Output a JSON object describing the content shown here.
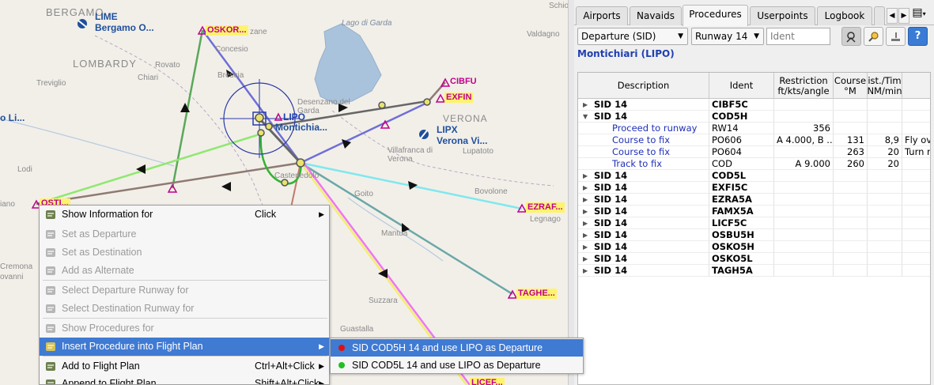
{
  "map": {
    "labels": {
      "bergamo": "BERGAMO",
      "lime_code": "LIME",
      "lime_name": "Bergamo O...",
      "lombardy": "LOMBARDY",
      "rovato": "Rovato",
      "treviglio": "Treviglio",
      "chiari": "Chiari",
      "concesio": "Concesio",
      "lago": "Lago di Garda",
      "valdagno": "Valdagno",
      "schio": "Schio",
      "brescia": "Brescia",
      "desenzano": "Desenzano del\nGarda",
      "verona": "VERONA",
      "lipx_code": "LIPX",
      "lipx_name": "Verona Vi...",
      "villafranca": "Villafranca di\nVerona",
      "lupatoto": "Lupatoto",
      "lipo_code": "LIPO",
      "lipo_name": "Montichia...",
      "castenedolo": "Castenedolo",
      "zane": "zane",
      "lodi": "Lodi",
      "lo_left": "o Li...",
      "iano": "iano",
      "goito": "Goito",
      "bovolone": "Bovolone",
      "legnago": "Legnago",
      "mantua": "Mantua",
      "suzzara": "Suzzara",
      "guastalla": "Guastalla",
      "vanni": "ovanni",
      "cremona": "Cremona"
    },
    "fixes": {
      "oskor": "OSKOR...",
      "cibfu": "CIBFU",
      "exfin": "EXFIN",
      "ezraf": "EZRAF...",
      "taghe": "TAGHE...",
      "licef": "LICEF...",
      "ostil": "OSTI..."
    },
    "colors": {
      "background": "#f2efe9",
      "lake": "#aac3dc",
      "route_green_dark": "#5aa85a",
      "route_green_light": "#8fe86f",
      "route_blue": "#6f6fd8",
      "route_brown": "#8e7a72",
      "route_cyan": "#7fe8ee",
      "route_teal": "#6aa8a8",
      "route_magenta": "#ee77ee",
      "route_yellow": "#f2ee6f",
      "route_grey": "#666666",
      "fix": "#c0008a"
    }
  },
  "panel": {
    "tabs": [
      {
        "label": "Airports",
        "active": false
      },
      {
        "label": "Navaids",
        "active": false
      },
      {
        "label": "Procedures",
        "active": true
      },
      {
        "label": "Userpoints",
        "active": false
      },
      {
        "label": "Logbook",
        "active": false
      }
    ],
    "tab_more_label": "",
    "menu_icon": "panel-menu-icon",
    "filter": {
      "type_value": "Departure (SID)",
      "runway_value": "Runway 14",
      "ident_placeholder": "Ident"
    },
    "toolbar_icons": [
      "follow-selection-icon",
      "search-icon",
      "clear-selection-icon",
      "help-icon"
    ],
    "help_label": "?",
    "airport_title": "Montichiari (LIPO)",
    "table": {
      "headers": [
        "Description",
        "Ident",
        "Restriction\nft/kts/angle",
        "Course\n°M",
        "ist./Tim\nNM/min",
        ""
      ],
      "rows": [
        {
          "type": "parent",
          "expanded": false,
          "desc": "SID 14",
          "ident": "CIBF5C",
          "restr": "",
          "course": "",
          "dist": "",
          "remarks": ""
        },
        {
          "type": "parent",
          "expanded": true,
          "desc": "SID 14",
          "ident": "COD5H",
          "restr": "",
          "course": "",
          "dist": "",
          "remarks": ""
        },
        {
          "type": "child",
          "desc": "Proceed to runway",
          "ident": "RW14",
          "restr": "356",
          "course": "",
          "dist": "",
          "remarks": ""
        },
        {
          "type": "child",
          "desc": "Course to fix",
          "ident": "PO606",
          "restr": "A 4.000, B ...",
          "course": "131",
          "dist": "8,9",
          "remarks": "Fly ov"
        },
        {
          "type": "child",
          "desc": "Course to fix",
          "ident": "PO604",
          "restr": "",
          "course": "263",
          "dist": "20",
          "remarks": "Turn r"
        },
        {
          "type": "child",
          "desc": "Track to fix",
          "ident": "COD",
          "restr": "A 9.000",
          "course": "260",
          "dist": "20",
          "remarks": ""
        },
        {
          "type": "parent",
          "expanded": false,
          "desc": "SID 14",
          "ident": "COD5L",
          "restr": "",
          "course": "",
          "dist": "",
          "remarks": ""
        },
        {
          "type": "parent",
          "expanded": false,
          "desc": "SID 14",
          "ident": "EXFI5C",
          "restr": "",
          "course": "",
          "dist": "",
          "remarks": ""
        },
        {
          "type": "parent",
          "expanded": false,
          "desc": "SID 14",
          "ident": "EZRA5A",
          "restr": "",
          "course": "",
          "dist": "",
          "remarks": ""
        },
        {
          "type": "parent",
          "expanded": false,
          "desc": "SID 14",
          "ident": "FAMX5A",
          "restr": "",
          "course": "",
          "dist": "",
          "remarks": ""
        },
        {
          "type": "parent",
          "expanded": false,
          "desc": "SID 14",
          "ident": "LICF5C",
          "restr": "",
          "course": "",
          "dist": "",
          "remarks": ""
        },
        {
          "type": "parent",
          "expanded": false,
          "desc": "SID 14",
          "ident": "OSBU5H",
          "restr": "",
          "course": "",
          "dist": "",
          "remarks": ""
        },
        {
          "type": "parent",
          "expanded": false,
          "desc": "SID 14",
          "ident": "OSKO5H",
          "restr": "",
          "course": "",
          "dist": "",
          "remarks": ""
        },
        {
          "type": "parent",
          "expanded": false,
          "desc": "SID 14",
          "ident": "OSKO5L",
          "restr": "",
          "course": "",
          "dist": "",
          "remarks": ""
        },
        {
          "type": "parent",
          "expanded": false,
          "desc": "SID 14",
          "ident": "TAGH5A",
          "restr": "",
          "course": "",
          "dist": "",
          "remarks": ""
        }
      ]
    }
  },
  "context_menu": {
    "items": [
      {
        "label": "Show Information for",
        "shortcut": "Click",
        "submenu": true,
        "disabled": false,
        "highlighted": false,
        "icon": "info-icon"
      },
      {
        "label": "Set  as Departure",
        "shortcut": "",
        "submenu": false,
        "disabled": true,
        "highlighted": false,
        "icon": "departure-icon"
      },
      {
        "label": "Set  as Destination",
        "shortcut": "",
        "submenu": false,
        "disabled": true,
        "highlighted": false,
        "icon": "destination-icon"
      },
      {
        "label": "Add  as Alternate",
        "shortcut": "",
        "submenu": false,
        "disabled": true,
        "highlighted": false,
        "icon": "alternate-icon"
      },
      {
        "label": "Select Departure Runway for",
        "shortcut": "",
        "submenu": false,
        "disabled": true,
        "highlighted": false,
        "icon": "departure-runway-icon"
      },
      {
        "label": "Select Destination Runway for",
        "shortcut": "",
        "submenu": false,
        "disabled": true,
        "highlighted": false,
        "icon": "destination-runway-icon"
      },
      {
        "label": "Show Procedures for",
        "shortcut": "",
        "submenu": false,
        "disabled": true,
        "highlighted": false,
        "icon": "procedures-icon"
      },
      {
        "label": "Insert Procedure  into Flight Plan",
        "shortcut": "",
        "submenu": true,
        "disabled": false,
        "highlighted": true,
        "icon": "insert-procedure-icon"
      },
      {
        "label": "Add to Flight Plan",
        "shortcut": "Ctrl+Alt+Click",
        "submenu": true,
        "disabled": false,
        "highlighted": false,
        "icon": "add-flightplan-icon"
      },
      {
        "label": "Append  to Flight Plan",
        "shortcut": "Shift+Alt+Click",
        "submenu": true,
        "disabled": false,
        "highlighted": false,
        "icon": "append-flightplan-icon"
      }
    ],
    "submenu": [
      {
        "label": "SID COD5H 14 and use LIPO as Departure",
        "dot_color": "#e01010",
        "highlighted": true
      },
      {
        "label": "SID COD5L 14 and use LIPO as Departure",
        "dot_color": "#20c020",
        "highlighted": false
      }
    ]
  }
}
